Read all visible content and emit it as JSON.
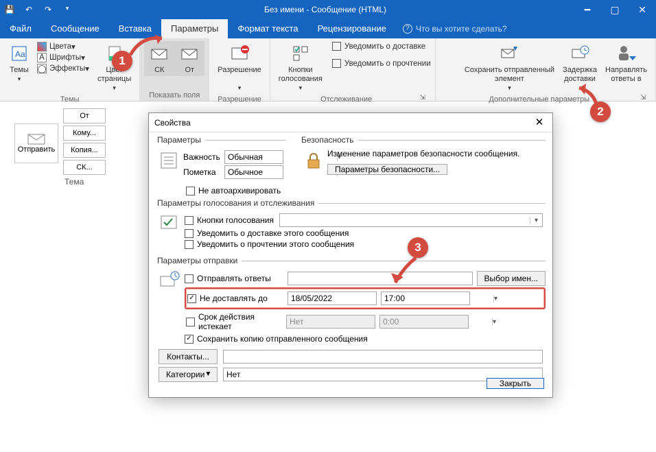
{
  "titlebar": {
    "title": "Без имени - Сообщение (HTML)"
  },
  "tabs": {
    "file": "Файл",
    "message": "Сообщение",
    "insert": "Вставка",
    "options": "Параметры",
    "format": "Формат текста",
    "review": "Рецензирование",
    "tellme": "Что вы хотите сделать?"
  },
  "ribbon": {
    "themes_label": "Темы",
    "themes_btn": "Темы",
    "colors": "Цвета",
    "fonts": "Шрифты",
    "effects": "Эффекты",
    "pagecolor": "Цвет\nстраницы",
    "bcc": "СК",
    "from": "От",
    "showfields_label": "Показать поля",
    "permission": "Разрешение",
    "permission_label": "Разрешение",
    "voting": "Кнопки\nголосования",
    "req_delivery": "Уведомить о доставке",
    "req_read": "Уведомить о прочтении",
    "tracking_label": "Отслеживание",
    "save_sent": "Сохранить отправленный\nэлемент",
    "delay": "Задержка\nдоставки",
    "direct": "Направлять\nответы в",
    "moreopts_label": "Дополнительные параметры"
  },
  "compose": {
    "send": "Отправить",
    "from_btn": "От",
    "to_btn": "Кому...",
    "cc_btn": "Копия...",
    "bcc_btn": "СК...",
    "subject_lbl": "Тема"
  },
  "dialog": {
    "title": "Свойства",
    "fs_params": "Параметры",
    "fs_security": "Безопасность",
    "importance_lbl": "Важность",
    "importance_val": "Обычная",
    "sensitivity_lbl": "Пометка",
    "sensitivity_val": "Обычное",
    "noautoarchive": "Не автоархивировать",
    "sec_text": "Изменение параметров безопасности сообщения.",
    "sec_btn": "Параметры безопасности...",
    "fs_voting": "Параметры голосования и отслеживания",
    "voting_chk": "Кнопки голосования",
    "rcpt_deliv": "Уведомить о доставке этого сообщения",
    "rcpt_read": "Уведомить о прочтении этого сообщения",
    "fs_delivery": "Параметры отправки",
    "send_replies": "Отправлять ответы",
    "select_names": "Выбор имен...",
    "defer": "Не доставлять до",
    "defer_date": "18/05/2022",
    "defer_time": "17:00",
    "expires": "Срок действия истекает",
    "expires_date": "Нет",
    "expires_time": "0:00",
    "save_copy": "Сохранить копию отправленного сообщения",
    "contacts_btn": "Контакты...",
    "categories_btn": "Категории",
    "categories_val": "Нет",
    "close": "Закрыть"
  },
  "callouts": {
    "c1": "1",
    "c2": "2",
    "c3": "3"
  }
}
